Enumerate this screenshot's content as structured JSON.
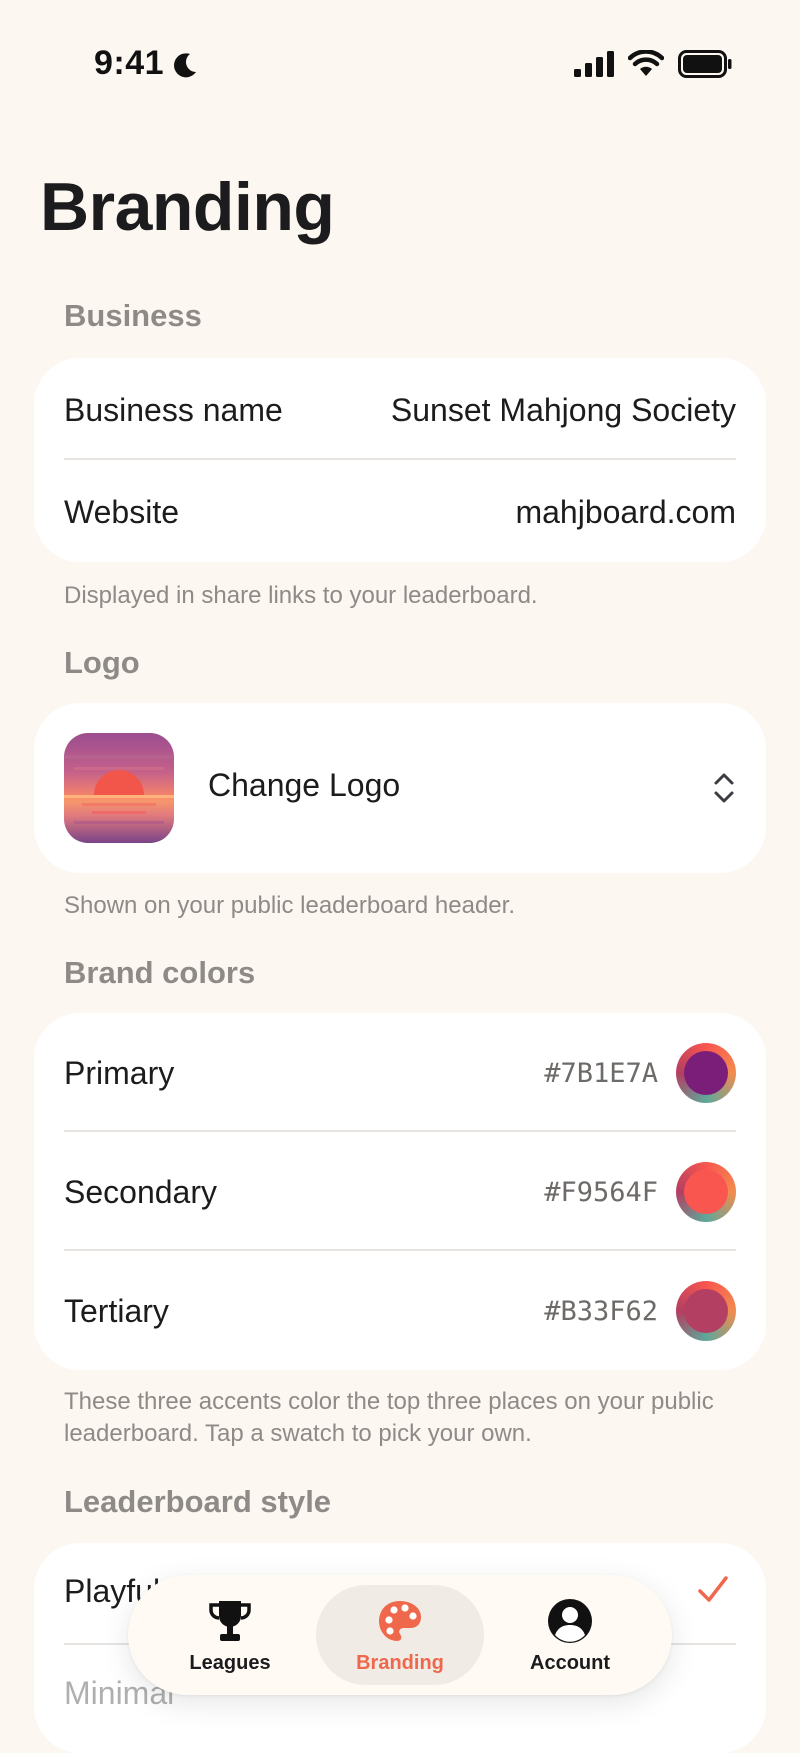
{
  "status_bar": {
    "time": "9:41"
  },
  "page": {
    "title": "Branding"
  },
  "business": {
    "header": "Business",
    "rows": [
      {
        "label": "Business name",
        "value": "Sunset Mahjong Society"
      },
      {
        "label": "Website",
        "value": "mahjboard.com"
      }
    ],
    "footnote": "Displayed in share links to your leaderboard."
  },
  "logo": {
    "header": "Logo",
    "button_label": "Change Logo",
    "footnote": "Shown on your public leaderboard header."
  },
  "brand_colors": {
    "header": "Brand colors",
    "rows": [
      {
        "label": "Primary",
        "hex": "#7B1E7A",
        "color": "#7b1e7a"
      },
      {
        "label": "Secondary",
        "hex": "#F9564F",
        "color": "#f9564f"
      },
      {
        "label": "Tertiary",
        "hex": "#B33F62",
        "color": "#b33f62"
      }
    ],
    "footnote": "These three accents color the top three places on your public leaderboard. Tap a swatch to pick your own."
  },
  "leaderboard_style": {
    "header": "Leaderboard style",
    "options": [
      {
        "label": "Playful",
        "selected": true
      },
      {
        "label": "Minimal",
        "selected": false
      }
    ]
  },
  "tab_bar": {
    "accent": "#f0684c",
    "tabs": [
      {
        "label": "Leagues",
        "icon": "trophy-icon",
        "active": false
      },
      {
        "label": "Branding",
        "icon": "palette-icon",
        "active": true
      },
      {
        "label": "Account",
        "icon": "person-circle-icon",
        "active": false
      }
    ]
  }
}
